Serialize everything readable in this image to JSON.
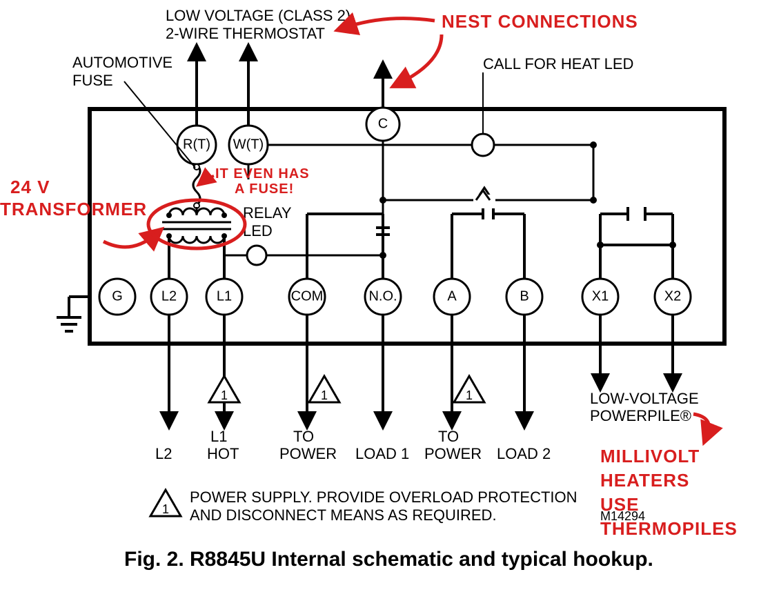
{
  "title_line1": "LOW VOLTAGE (CLASS 2)",
  "title_line2": "2-WIRE THERMOSTAT",
  "automotive_fuse_l1": "AUTOMOTIVE",
  "automotive_fuse_l2": "FUSE",
  "call_led": "CALL FOR HEAT LED",
  "terminals": {
    "RT": "R(T)",
    "WT": "W(T)",
    "C": "C",
    "G": "G",
    "L2": "L2",
    "L1": "L1",
    "COM": "COM",
    "NO": "N.O.",
    "A": "A",
    "B": "B",
    "X1": "X1",
    "X2": "X2"
  },
  "relay": "RELAY",
  "relay_led": "LED",
  "tri_digit": "1",
  "bottom": {
    "L2": "L2",
    "L1a": "L1",
    "L1b": "HOT",
    "TOa": "TO",
    "TOb": "POWER",
    "LOAD1": "LOAD 1",
    "LOAD2": "LOAD 2",
    "LVP1": "LOW-VOLTAGE",
    "LVP2": "POWERPILE®"
  },
  "legend1": "POWER SUPPLY. PROVIDE OVERLOAD PROTECTION",
  "legend2": "AND DISCONNECT MEANS AS REQUIRED.",
  "docnum": "M14294",
  "caption": "Fig. 2. R8845U Internal schematic and typical hookup.",
  "annotations": {
    "nest": "NEST CONNECTIONS",
    "xfmr1": "24 V",
    "xfmr2": "TRANSFORMER",
    "fuse1": "IT EVEN HAS",
    "fuse2": "A FUSE!",
    "mv1": "MILLIVOLT",
    "mv2": "HEATERS",
    "mv3": "USE",
    "mv4": "THERMOPILES"
  }
}
